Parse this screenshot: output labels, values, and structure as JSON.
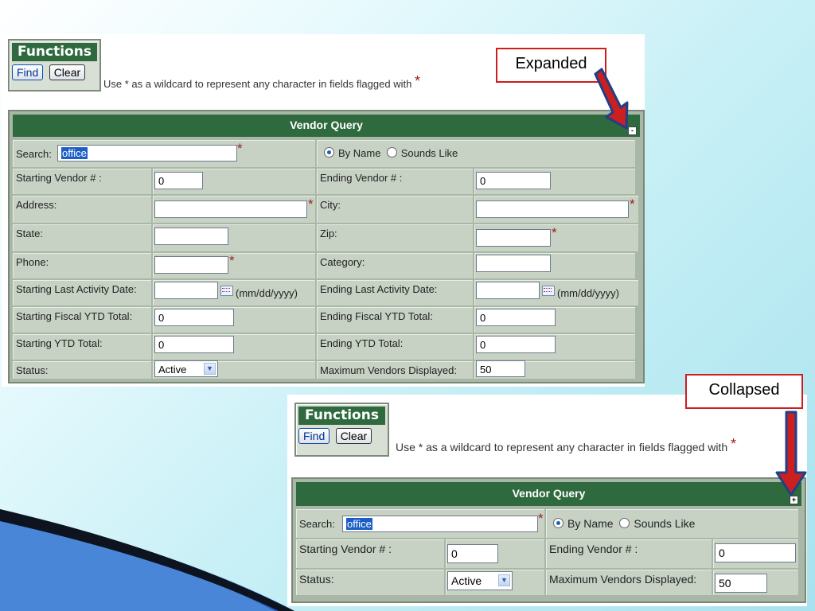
{
  "expanded": {
    "functions_title": "Functions",
    "find_label": "Find",
    "clear_label": "Clear",
    "hint": "Use * as a wildcard to represent any character in fields flagged with",
    "hint_star": "*",
    "query_title": "Vendor Query",
    "toggle_symbol": "-",
    "search_label": "Search:",
    "search_value": "office",
    "by_name": "By Name",
    "sounds_like": "Sounds Like",
    "starting_vendor_label": "Starting Vendor # :",
    "starting_vendor_value": "0",
    "ending_vendor_label": "Ending Vendor # :",
    "ending_vendor_value": "0",
    "address_label": "Address:",
    "city_label": "City:",
    "state_label": "State:",
    "zip_label": "Zip:",
    "phone_label": "Phone:",
    "category_label": "Category:",
    "start_activity_label": "Starting Last Activity Date:",
    "end_activity_label": "Ending Last Activity Date:",
    "date_format": "(mm/dd/yyyy)",
    "start_fiscal_label": "Starting Fiscal YTD Total:",
    "start_fiscal_value": "0",
    "end_fiscal_label": "Ending Fiscal YTD Total:",
    "end_fiscal_value": "0",
    "start_ytd_label": "Starting YTD Total:",
    "start_ytd_value": "0",
    "end_ytd_label": "Ending YTD Total:",
    "end_ytd_value": "0",
    "status_label": "Status:",
    "status_value": "Active",
    "max_vendors_label": "Maximum Vendors Displayed:",
    "max_vendors_value": "50",
    "req_star": "*"
  },
  "collapsed": {
    "functions_title": "Functions",
    "find_label": "Find",
    "clear_label": "Clear",
    "hint": "Use * as a wildcard to represent any character in fields flagged with",
    "hint_star": "*",
    "query_title": "Vendor Query",
    "toggle_symbol": "+",
    "search_label": "Search:",
    "search_value": "office",
    "by_name": "By Name",
    "sounds_like": "Sounds Like",
    "starting_vendor_label": "Starting Vendor # :",
    "starting_vendor_value": "0",
    "ending_vendor_label": "Ending Vendor # :",
    "ending_vendor_value": "0",
    "status_label": "Status:",
    "status_value": "Active",
    "max_vendors_label": "Maximum Vendors Displayed:",
    "max_vendors_value": "50",
    "req_star": "*"
  },
  "callouts": {
    "expanded": "Expanded",
    "collapsed": "Collapsed"
  },
  "colors": {
    "header_green": "#2e6a3e",
    "cell_bg": "#c7d2c4",
    "required_star": "#9b1c1c",
    "callout_border": "#d11c1c"
  }
}
